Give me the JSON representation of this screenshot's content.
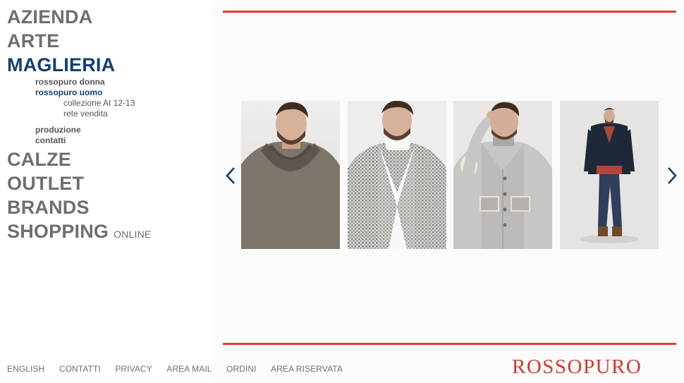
{
  "menu": {
    "azienda": "AZIENDA",
    "arte": "ARTE",
    "maglieria": "MAGLIERIA",
    "maglieria_sub": {
      "donna": "rossopuro donna",
      "uomo": "rossopuro uomo",
      "uomo_sub": {
        "collezione": "collezione AI 12-13",
        "rete": "rete vendita"
      },
      "produzione": "produzione",
      "contatti": "contatti"
    },
    "calze": "CALZE",
    "outlet": "OUTLET",
    "brands": "BRANDS",
    "shopping": "SHOPPING",
    "shopping_suffix": "ONLINE"
  },
  "carousel": {
    "prev_icon": "chevron-left-icon",
    "next_icon": "chevron-right-icon",
    "accent": "#14406b",
    "photos": [
      "man-grey-shawl-sweater",
      "man-houndstooth-cardigan",
      "man-grey-button-cardigan",
      "man-navy-jacket-full-length"
    ]
  },
  "footer": {
    "links": [
      "ENGLISH",
      "CONTATTI",
      "PRIVACY",
      "AREA MAIL",
      "ORDINI",
      "AREA RISERVATA"
    ]
  },
  "brand": {
    "logo_text": "ROSSOPURO",
    "color": "#cb3b2e"
  }
}
